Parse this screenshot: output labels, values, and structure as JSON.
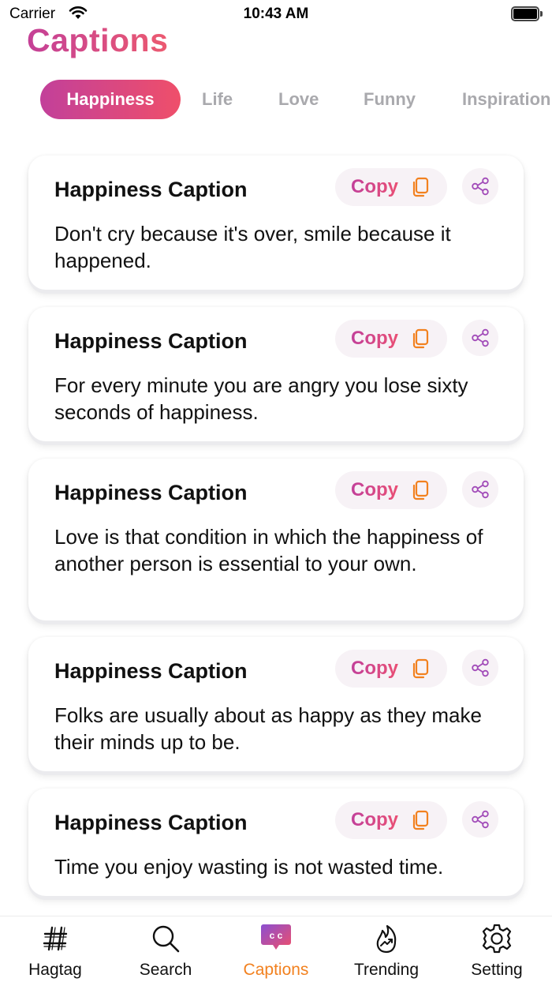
{
  "status_bar": {
    "carrier": "Carrier",
    "time": "10:43 AM"
  },
  "header": {
    "title": "Captions"
  },
  "categories": [
    {
      "label": "Happiness",
      "active": true
    },
    {
      "label": "Life",
      "active": false
    },
    {
      "label": "Love",
      "active": false
    },
    {
      "label": "Funny",
      "active": false
    },
    {
      "label": "Inspiration",
      "active": false
    }
  ],
  "captions": [
    {
      "title": "Happiness Caption",
      "copy_label": "Copy",
      "text": "Don't cry because it's over, smile because it happened."
    },
    {
      "title": "Happiness Caption",
      "copy_label": "Copy",
      "text": "For every minute you are angry you lose sixty seconds of happiness."
    },
    {
      "title": "Happiness Caption",
      "copy_label": "Copy",
      "text": "Love is that condition in which the happiness of another person is essential to your own."
    },
    {
      "title": "Happiness Caption",
      "copy_label": "Copy",
      "text": "Folks are usually about as happy as they make their minds up to be."
    },
    {
      "title": "Happiness Caption",
      "copy_label": "Copy",
      "text": "Time you enjoy wasting is not wasted time."
    }
  ],
  "bottom_nav": [
    {
      "label": "Hagtag",
      "icon": "hashtag-icon",
      "active": false
    },
    {
      "label": "Search",
      "icon": "search-icon",
      "active": false
    },
    {
      "label": "Captions",
      "icon": "captions-icon",
      "active": true
    },
    {
      "label": "Trending",
      "icon": "trending-icon",
      "active": false
    },
    {
      "label": "Setting",
      "icon": "gear-icon",
      "active": false
    }
  ],
  "colors": {
    "brand_gradient_start": "#c2409a",
    "brand_gradient_end": "#ef4f6a",
    "active_nav": "#f2811f",
    "inactive_tab": "#a9a9ad"
  }
}
